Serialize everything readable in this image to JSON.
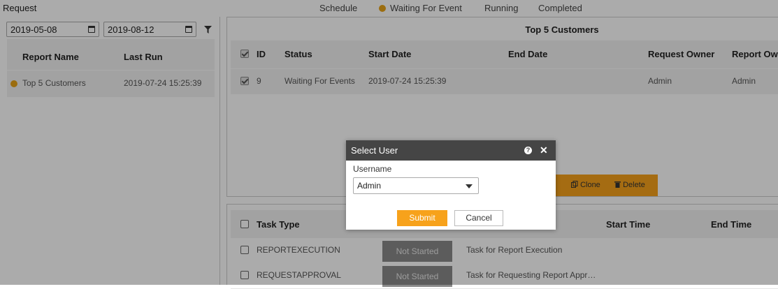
{
  "header": {
    "title": "Request",
    "tabs": [
      {
        "label": "Schedule"
      },
      {
        "label": "Waiting For Event",
        "active": true
      },
      {
        "label": "Running"
      },
      {
        "label": "Completed"
      }
    ],
    "status_dot_color": "#e8a317"
  },
  "filters": {
    "start_date": "2019-05-08",
    "end_date": "2019-08-12"
  },
  "report_list": {
    "columns": [
      "Report Name",
      "Last Run"
    ],
    "rows": [
      {
        "name": "Top 5 Customers",
        "last_run": "2019-07-24 15:25:39"
      }
    ]
  },
  "requests": {
    "title": "Top 5 Customers",
    "columns": [
      "ID",
      "Status",
      "Start Date",
      "End Date",
      "Request Owner",
      "Report Own"
    ],
    "rows": [
      {
        "id": "9",
        "status": "Waiting For Events",
        "start_date": "2019-07-24 15:25:39",
        "end_date": "",
        "request_owner": "Admin",
        "report_owner": "Admin"
      }
    ],
    "actions": {
      "clone": "Clone",
      "delete": "Delete"
    }
  },
  "tasks": {
    "columns": [
      "Task Type",
      "Start Time",
      "End Time"
    ],
    "rows": [
      {
        "type": "REPORTEXECUTION",
        "status": "Not Started",
        "description": "Task for Report Execution"
      },
      {
        "type": "REQUESTAPPROVAL",
        "status": "Not Started",
        "description": "Task for Requesting Report Appr…"
      }
    ]
  },
  "dialog": {
    "title": "Select User",
    "username_label": "Username",
    "username_value": "Admin",
    "submit_label": "Submit",
    "cancel_label": "Cancel",
    "help_glyph": "?"
  },
  "colors": {
    "accent": "#f7a21b",
    "dialog_header": "#454545",
    "badge": "#8a8a8a"
  }
}
